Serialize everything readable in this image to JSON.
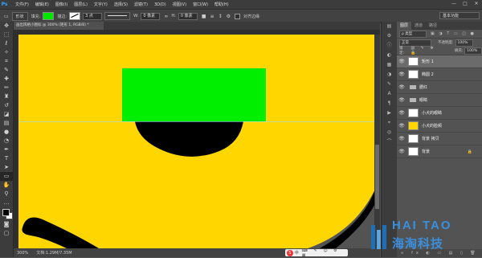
{
  "app": {
    "logo": "Ps"
  },
  "menu": [
    "文件(F)",
    "编辑(E)",
    "图像(I)",
    "图层(L)",
    "文字(Y)",
    "选择(S)",
    "滤镜(T)",
    "3D(D)",
    "视图(V)",
    "窗口(W)",
    "帮助(H)"
  ],
  "window_controls": [
    "—",
    "□",
    "✕"
  ],
  "options_bar": {
    "mode": "形状",
    "fill_label": "填充:",
    "stroke_label": "描边:",
    "stroke_width": "3 点",
    "w_label": "W:",
    "w_value": "0 像素",
    "h_label": "H:",
    "h_value": "0 像素",
    "align_edges": "对齐边缘",
    "workspace": "基本功能",
    "fill_color": "#00e800",
    "stroke_color": "#ffffff"
  },
  "document": {
    "tab_title": "画出风格小图标 @ 300% (矩形 1, RGB/8) *"
  },
  "canvas_colors": {
    "background": "#ffd600",
    "rectangle": "#00ee00",
    "shape": "#000000"
  },
  "status": {
    "zoom": "300%",
    "doc_info": "文档:1.29M/7.35M"
  },
  "ime": {
    "logo": "S",
    "label": "中",
    "icons": "⌨ ✎ ☺ ⚙ ▦"
  },
  "panel": {
    "tabs": [
      "图层",
      "通道",
      "路径"
    ],
    "kind": "ρ 类型",
    "blend_mode": "正常",
    "opacity_label": "不透明度:",
    "opacity_value": "100%",
    "lock_label": "锁定:",
    "fill_label": "填充:",
    "fill_value": "100%",
    "footer_icons": "∞ fx ◐ ▭ ▤ ▯ 🗑"
  },
  "layers": [
    {
      "name": "矩形 1",
      "type": "shape",
      "selected": true
    },
    {
      "name": "椭圆 2",
      "type": "shape",
      "selected": false
    },
    {
      "name": "腮红",
      "type": "folder",
      "selected": false
    },
    {
      "name": "眼睛",
      "type": "folder",
      "selected": false
    },
    {
      "name": "小犬的眼睛",
      "type": "shape",
      "selected": false
    },
    {
      "name": "小犬的脸颊",
      "type": "shape",
      "selected": false
    },
    {
      "name": "背景 拷贝",
      "type": "pixel",
      "selected": false
    },
    {
      "name": "背景",
      "type": "pixel",
      "selected": false,
      "locked": true
    }
  ],
  "watermark": {
    "en": "HAI TAO",
    "cn": "海淘科技"
  },
  "tools_icons": [
    "move-icon",
    "marquee-icon",
    "lasso-icon",
    "magic-wand-icon",
    "crop-icon",
    "eyedropper-icon",
    "healing-icon",
    "brush-icon",
    "stamp-icon",
    "history-brush-icon",
    "eraser-icon",
    "gradient-icon",
    "blur-icon",
    "dodge-icon",
    "pen-icon",
    "type-icon",
    "path-select-icon",
    "rectangle-tool-icon",
    "hand-icon",
    "zoom-icon"
  ]
}
